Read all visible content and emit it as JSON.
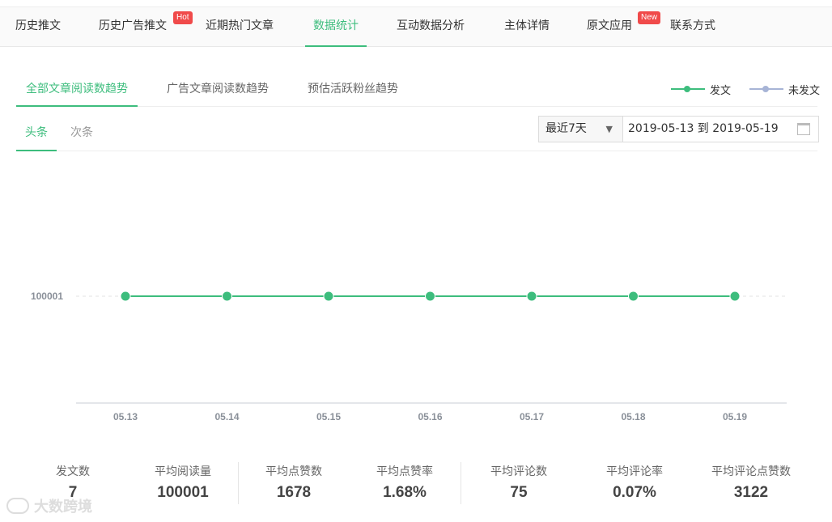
{
  "top_nav": [
    {
      "label": "历史推文"
    },
    {
      "label": "历史广告推文",
      "badge": "Hot"
    },
    {
      "label": "近期热门文章"
    },
    {
      "label": "数据统计",
      "active": true
    },
    {
      "label": "互动数据分析"
    },
    {
      "label": "主体详情"
    },
    {
      "label": "原文应用",
      "badge": "New"
    },
    {
      "label": "联系方式"
    }
  ],
  "sub_tabs": [
    {
      "label": "全部文章阅读数趋势",
      "active": true
    },
    {
      "label": "广告文章阅读数趋势"
    },
    {
      "label": "预估活跃粉丝趋势"
    }
  ],
  "legend": [
    {
      "label": "发文",
      "color": "#3dbd7d"
    },
    {
      "label": "未发文",
      "color": "#a7b4d6"
    }
  ],
  "position_tabs": [
    {
      "label": "头条",
      "active": true
    },
    {
      "label": "次条"
    }
  ],
  "range_select": {
    "value": "最近7天"
  },
  "date_range": {
    "value": "2019-05-13 到 2019-05-19"
  },
  "chart_data": {
    "type": "line",
    "categories": [
      "05.13",
      "05.14",
      "05.15",
      "05.16",
      "05.17",
      "05.18",
      "05.19"
    ],
    "series": [
      {
        "name": "发文",
        "color": "#3dbd7d",
        "values": [
          100001,
          100001,
          100001,
          100001,
          100001,
          100001,
          100001
        ]
      }
    ],
    "y_ticks": [
      "100001"
    ],
    "grid": "dashed",
    "xlabel": "",
    "ylabel": ""
  },
  "stats": [
    {
      "label": "发文数",
      "value": "7"
    },
    {
      "label": "平均阅读量",
      "value": "100001"
    },
    {
      "label": "平均点赞数",
      "value": "1678"
    },
    {
      "label": "平均点赞率",
      "value": "1.68%"
    },
    {
      "label": "平均评论数",
      "value": "75"
    },
    {
      "label": "平均评论率",
      "value": "0.07%"
    },
    {
      "label": "平均评论点赞数",
      "value": "3122"
    }
  ],
  "watermark": "大数跨境"
}
